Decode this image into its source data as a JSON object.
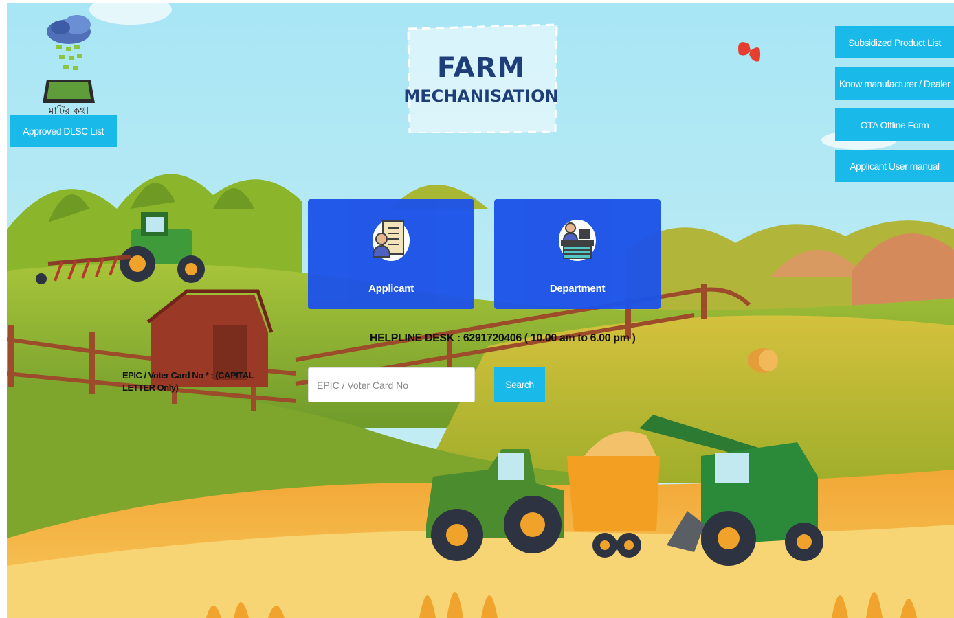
{
  "title": {
    "line1": "FARM",
    "line2": "MECHANISATION"
  },
  "logo": {
    "caption": "মাটির কথা"
  },
  "left_button": {
    "label": "Approved DLSC List"
  },
  "side_buttons": [
    {
      "label": "Subsidized Product List"
    },
    {
      "label": "Know manufacturer / Dealer"
    },
    {
      "label": "OTA Offline Form"
    },
    {
      "label": "Applicant User manual"
    }
  ],
  "cards": {
    "applicant": {
      "label": "Applicant",
      "icon": "document-user-icon"
    },
    "department": {
      "label": "Department",
      "icon": "desk-officer-icon"
    }
  },
  "helpline": {
    "text": "HELPLINE DESK : 6291720406 ( 10.00 am to 6.00 pm )"
  },
  "epic": {
    "label": "EPIC / Voter Card No * : (CAPITAL LETTER Only)",
    "placeholder": "EPIC / Voter Card No",
    "value": "",
    "search_label": "Search"
  },
  "colors": {
    "accent": "#19b9ea",
    "card": "#1d52e8",
    "title": "#1d3e79"
  }
}
